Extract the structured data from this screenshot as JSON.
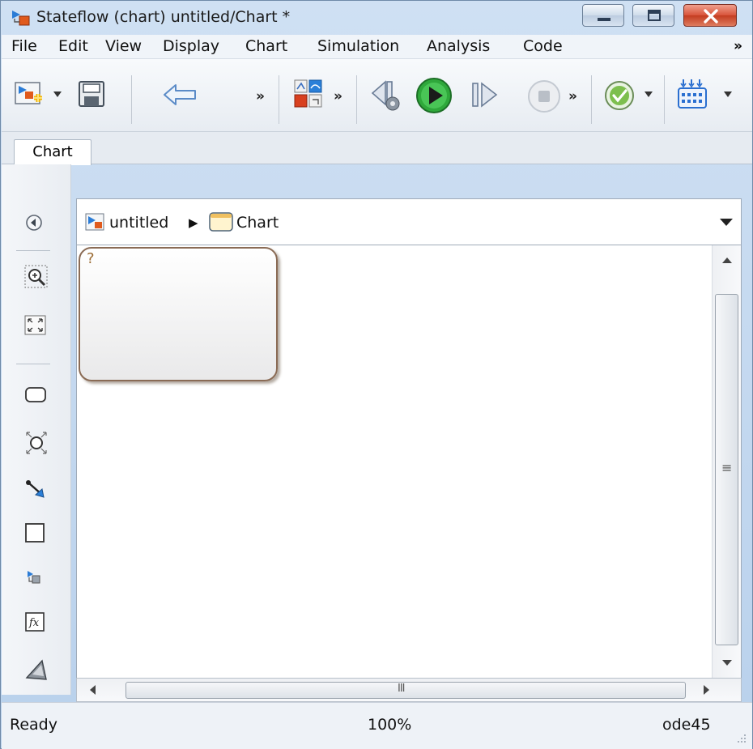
{
  "window": {
    "title": "Stateflow (chart) untitled/Chart *"
  },
  "menu": {
    "items": [
      "File",
      "Edit",
      "View",
      "Display",
      "Chart",
      "Simulation",
      "Analysis",
      "Code"
    ],
    "more": "»"
  },
  "toolbar": {
    "more_glyph": "»",
    "icons": [
      "new-model-icon",
      "save-icon",
      "back-arrow-icon",
      "model-explorer-icon",
      "step-back-icon",
      "run-icon",
      "step-forward-icon",
      "stop-icon",
      "check-model-icon",
      "library-icon"
    ]
  },
  "tabs": [
    {
      "label": "Chart"
    }
  ],
  "breadcrumb": {
    "model": "untitled",
    "separator": "▶",
    "chart": "Chart"
  },
  "canvas": {
    "state_label": "?"
  },
  "scrollbar": {
    "thumb_grip": "III",
    "vthumb_grip": "≡"
  },
  "status": {
    "left": "Ready",
    "zoom": "100%",
    "solver": "ode45"
  },
  "colors": {
    "title_bg": "#b9d1ec",
    "state_border": "#8a6b55",
    "run_green": "#2fa83b",
    "close_red": "#c33c20"
  }
}
